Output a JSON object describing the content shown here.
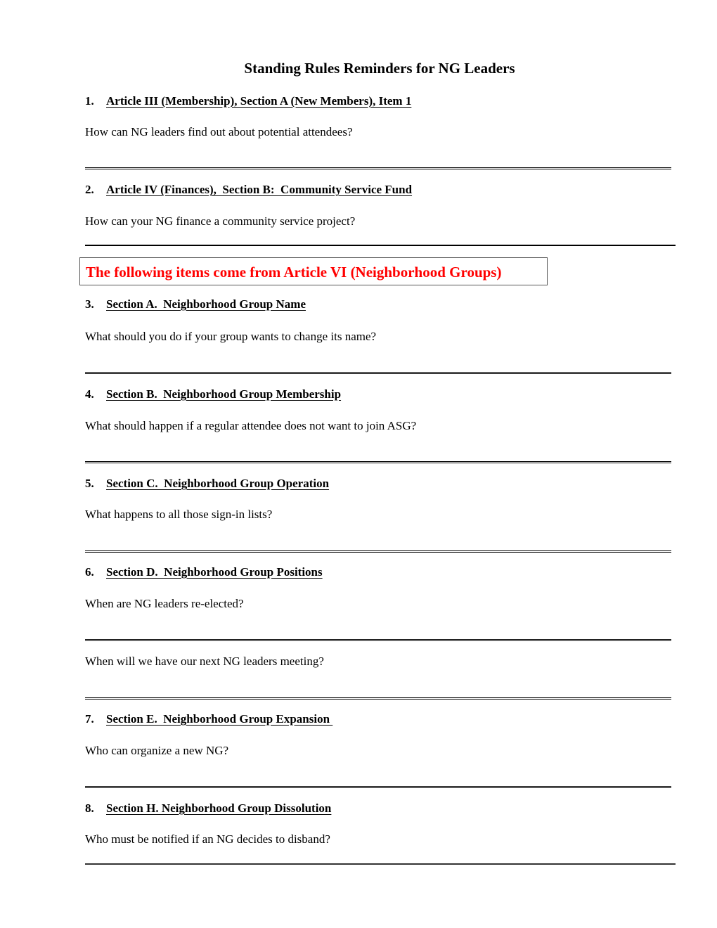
{
  "document": {
    "title": "Standing Rules Reminders for NG Leaders",
    "notice": {
      "text": "The following items come from Article VI (Neighborhood Groups)",
      "color": "#ff0000"
    },
    "items": [
      {
        "number": "1.",
        "heading": "Article III (Membership), Section A (New Members), Item 1",
        "questions": [
          "How can NG leaders find out about potential attendees?"
        ]
      },
      {
        "number": "2.",
        "heading": "Article IV (Finances),  Section B:  Community Service Fund",
        "questions": [
          "How can your NG finance a community service project?"
        ]
      },
      {
        "number": "3.",
        "heading": "Section A.  Neighborhood Group Name",
        "questions": [
          "What should you do if your group wants to change its name?"
        ]
      },
      {
        "number": "4.",
        "heading": "Section B.  Neighborhood Group Membership",
        "questions": [
          "What should happen if a regular attendee does not want to join ASG?"
        ]
      },
      {
        "number": "5.",
        "heading": "Section C.  Neighborhood Group Operation",
        "questions": [
          "What happens to all those sign-in lists?"
        ]
      },
      {
        "number": "6.",
        "heading": "Section D.  Neighborhood Group Positions",
        "questions": [
          "When are NG leaders re-elected?",
          "When will we have our next NG leaders meeting?"
        ]
      },
      {
        "number": "7.",
        "heading": "Section E.  Neighborhood Group Expansion ",
        "questions": [
          "Who can organize a new NG?"
        ]
      },
      {
        "number": "8.",
        "heading": "Section H. Neighborhood Group Dissolution",
        "questions": [
          "Who must be notified if an NG decides to disband?"
        ]
      }
    ]
  }
}
